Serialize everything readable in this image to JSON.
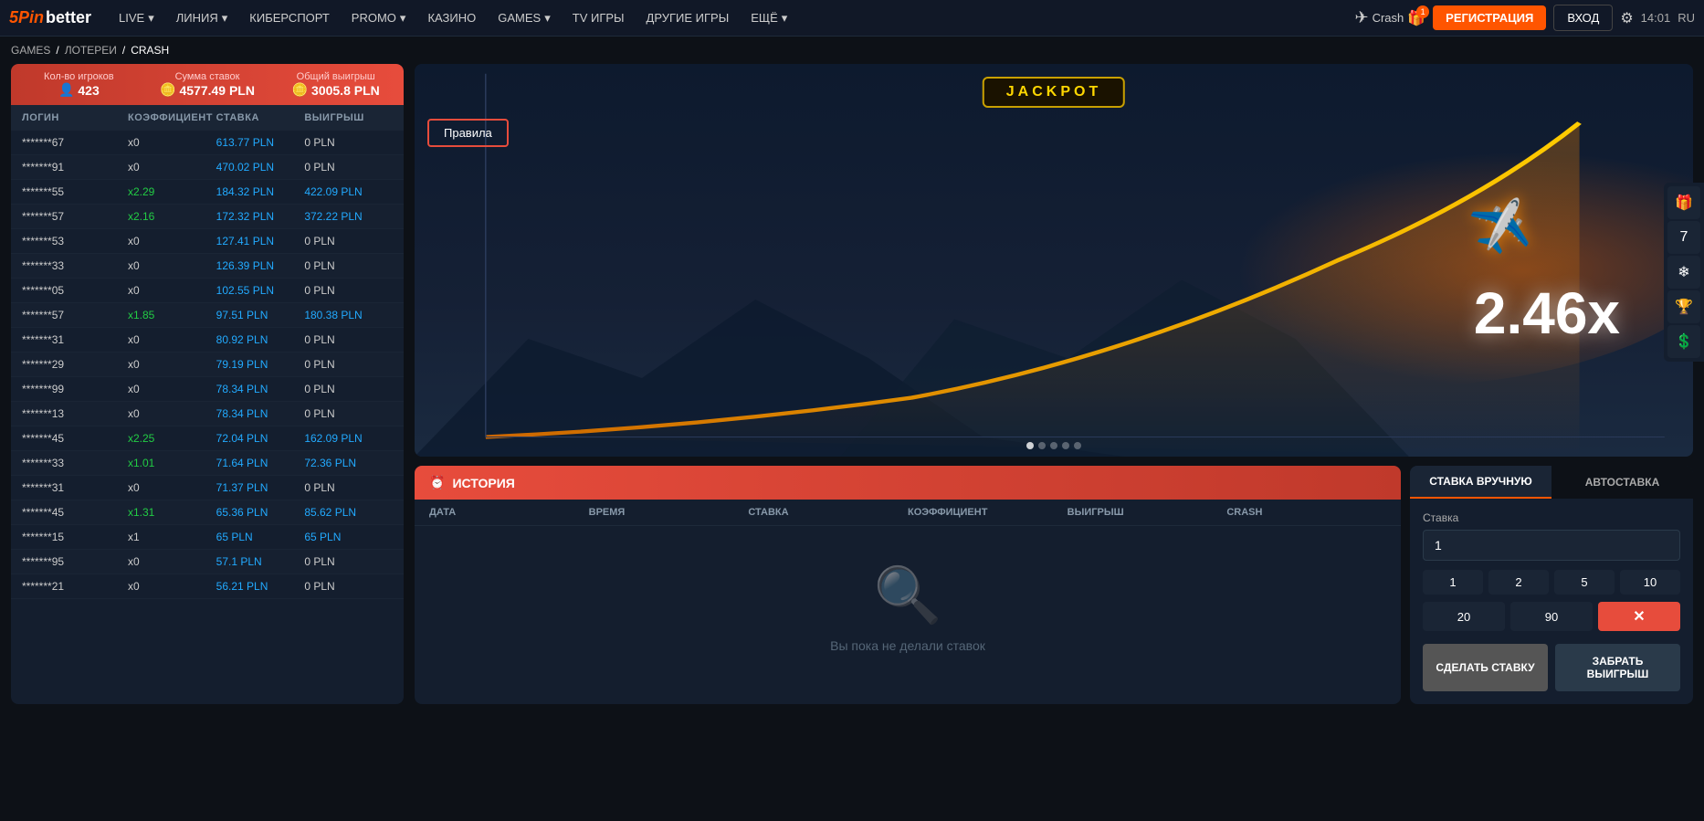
{
  "logo": {
    "spin": "5Pin",
    "better": "better"
  },
  "nav": {
    "items": [
      {
        "label": "LIVE",
        "hasArrow": true
      },
      {
        "label": "ЛИНИЯ",
        "hasArrow": true
      },
      {
        "label": "КИБЕРСПОРТ",
        "hasArrow": false
      },
      {
        "label": "PROMO",
        "hasArrow": true
      },
      {
        "label": "КАЗИНО",
        "hasArrow": false
      },
      {
        "label": "GAMES",
        "hasArrow": true
      },
      {
        "label": "TV ИГРЫ",
        "hasArrow": false
      },
      {
        "label": "ДРУГИЕ ИГРЫ",
        "hasArrow": false
      },
      {
        "label": "ЕЩЁ",
        "hasArrow": true
      }
    ],
    "crash_label": "Crash",
    "register_label": "РЕГИСТРАЦИЯ",
    "login_label": "ВХОД",
    "time": "14:01",
    "lang": "RU"
  },
  "breadcrumb": {
    "parts": [
      "GAMES",
      "/",
      "ЛОТЕРЕИ",
      "/",
      "CRASH"
    ]
  },
  "stats": {
    "players_label": "Кол-во игроков",
    "players_value": "423",
    "bets_label": "Сумма ставок",
    "bets_value": "4577.49 PLN",
    "wins_label": "Общий выигрыш",
    "wins_value": "3005.8 PLN"
  },
  "table": {
    "headers": [
      "ЛОГИН",
      "КОЭФФИЦИЕНТ",
      "СТАВКА",
      "ВЫИГРЫШ"
    ],
    "rows": [
      {
        "login": "*******67",
        "coeff": "x0",
        "bet": "613.77 PLN",
        "win": "0 PLN",
        "coeff_pos": false
      },
      {
        "login": "*******91",
        "coeff": "x0",
        "bet": "470.02 PLN",
        "win": "0 PLN",
        "coeff_pos": false
      },
      {
        "login": "*******55",
        "coeff": "x2.29",
        "bet": "184.32 PLN",
        "win": "422.09 PLN",
        "coeff_pos": true
      },
      {
        "login": "*******57",
        "coeff": "x2.16",
        "bet": "172.32 PLN",
        "win": "372.22 PLN",
        "coeff_pos": true
      },
      {
        "login": "*******53",
        "coeff": "x0",
        "bet": "127.41 PLN",
        "win": "0 PLN",
        "coeff_pos": false
      },
      {
        "login": "*******33",
        "coeff": "x0",
        "bet": "126.39 PLN",
        "win": "0 PLN",
        "coeff_pos": false
      },
      {
        "login": "*******05",
        "coeff": "x0",
        "bet": "102.55 PLN",
        "win": "0 PLN",
        "coeff_pos": false
      },
      {
        "login": "*******57",
        "coeff": "x1.85",
        "bet": "97.51 PLN",
        "win": "180.38 PLN",
        "coeff_pos": true
      },
      {
        "login": "*******31",
        "coeff": "x0",
        "bet": "80.92 PLN",
        "win": "0 PLN",
        "coeff_pos": false
      },
      {
        "login": "*******29",
        "coeff": "x0",
        "bet": "79.19 PLN",
        "win": "0 PLN",
        "coeff_pos": false
      },
      {
        "login": "*******99",
        "coeff": "x0",
        "bet": "78.34 PLN",
        "win": "0 PLN",
        "coeff_pos": false
      },
      {
        "login": "*******13",
        "coeff": "x0",
        "bet": "78.34 PLN",
        "win": "0 PLN",
        "coeff_pos": false
      },
      {
        "login": "*******45",
        "coeff": "x2.25",
        "bet": "72.04 PLN",
        "win": "162.09 PLN",
        "coeff_pos": true
      },
      {
        "login": "*******33",
        "coeff": "x1.01",
        "bet": "71.64 PLN",
        "win": "72.36 PLN",
        "coeff_pos": true
      },
      {
        "login": "*******31",
        "coeff": "x0",
        "bet": "71.37 PLN",
        "win": "0 PLN",
        "coeff_pos": false
      },
      {
        "login": "*******45",
        "coeff": "x1.31",
        "bet": "65.36 PLN",
        "win": "85.62 PLN",
        "coeff_pos": true
      },
      {
        "login": "*******15",
        "coeff": "x1",
        "bet": "65 PLN",
        "win": "65 PLN",
        "coeff_pos": false
      },
      {
        "login": "*******95",
        "coeff": "x0",
        "bet": "57.1 PLN",
        "win": "0 PLN",
        "coeff_pos": false
      },
      {
        "login": "*******21",
        "coeff": "x0",
        "bet": "56.21 PLN",
        "win": "0 PLN",
        "coeff_pos": false
      }
    ]
  },
  "game": {
    "jackpot_label": "JACKPOT",
    "rules_label": "Правила",
    "multiplier": "2.46x"
  },
  "history": {
    "title": "ИСТОРИЯ",
    "headers": [
      "ДАТА",
      "ВРЕМЯ",
      "СТАВКА",
      "КОЭФФИЦИЕНТ",
      "ВЫИГРЫШ",
      "CRASH"
    ],
    "empty_message": "Вы пока не делали ставок"
  },
  "bet_panel": {
    "tab_manual": "СТАВКА ВРУЧНУЮ",
    "tab_auto": "АВТОСТАВКА",
    "stake_label": "Ставка",
    "stake_value": "1",
    "quick_btns": [
      "1",
      "2",
      "5",
      "10"
    ],
    "quick_btns2": [
      "20",
      "90"
    ],
    "clear_label": "✕",
    "make_bet_label": "СДЕЛАТЬ СТАВКУ",
    "take_win_label": "ЗАБРАТЬ ВЫИГРЫШ"
  },
  "colors": {
    "accent": "#ff5500",
    "positive": "#22cc44",
    "neutral": "#cccccc",
    "highlight": "#22aaff",
    "bg_dark": "#0d1117",
    "bg_mid": "#141e2e"
  }
}
